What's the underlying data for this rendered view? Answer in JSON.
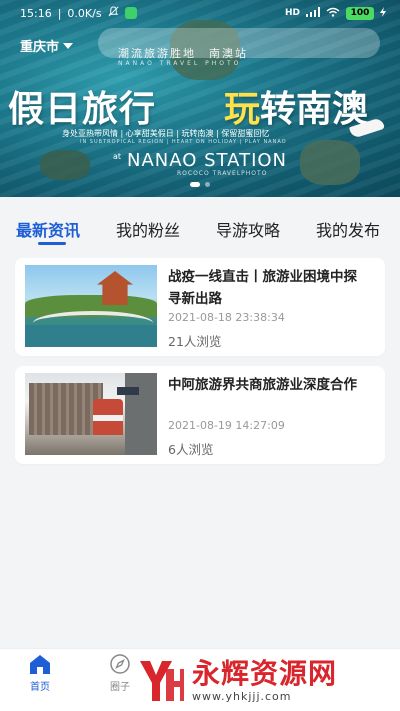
{
  "status_bar": {
    "time": "15:16",
    "speed": "0.0K/s",
    "network": "HD",
    "battery": "100"
  },
  "header": {
    "city": "重庆市"
  },
  "banner": {
    "subtitle_cn": "潮流旅游胜地　南澳站",
    "subtitle_en": "NANAO TRAVEL PHOTO",
    "title_left": "假日旅行",
    "title_right_accent": "玩",
    "title_right_rest": "转南澳",
    "tagline": "身处亚热带风情 | 心享甜美假日 | 玩转南澳 | 保留甜蜜回忆",
    "tagline_en": "IN SUBTROPICAL REGION | HEART ON HOLIDAY | PLAY NANAO",
    "station_at": "at",
    "station": "NANAO STATION",
    "station_sub": "ROCOCO TRAVELPHOTO"
  },
  "tabs": [
    {
      "label": "最新资讯",
      "active": true
    },
    {
      "label": "我的粉丝",
      "active": false
    },
    {
      "label": "导游攻略",
      "active": false
    },
    {
      "label": "我的发布",
      "active": false
    }
  ],
  "articles": [
    {
      "title": "战疫一线直击丨旅游业困境中探寻新出路",
      "date": "2021-08-18 23:38:34",
      "views": "21人浏览"
    },
    {
      "title": "中阿旅游界共商旅游业深度合作",
      "date": "2021-08-19 14:27:09",
      "views": "6人浏览"
    }
  ],
  "tabbar": [
    {
      "label": "首页",
      "icon": "home-icon",
      "active": true
    },
    {
      "label": "圈子",
      "icon": "compass-icon",
      "active": false
    },
    {
      "label": "",
      "icon": "",
      "active": false
    },
    {
      "label": "",
      "icon": "",
      "active": false
    },
    {
      "label": "",
      "icon": "",
      "active": false
    }
  ],
  "watermark": {
    "title": "永辉资源网",
    "url": "www.yhkjjj.com"
  },
  "colors": {
    "accent": "#1f5fd6",
    "watermark_red": "#d8262c",
    "banner_yellow": "#ffe14a"
  }
}
